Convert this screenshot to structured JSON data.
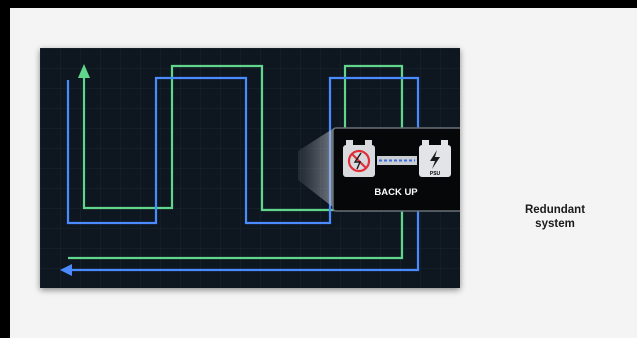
{
  "diagram": {
    "inset": {
      "label": "BACK UP",
      "left_icon": "failed-battery-icon",
      "right_icon": "psu-icon",
      "psu_label": "PSU"
    },
    "caption": {
      "line1": "Redundant",
      "line2": "system"
    },
    "colors": {
      "background": "#0e1620",
      "green_path": "#5fd68a",
      "blue_path": "#4a8cff",
      "fail_red": "#e0303a"
    }
  }
}
